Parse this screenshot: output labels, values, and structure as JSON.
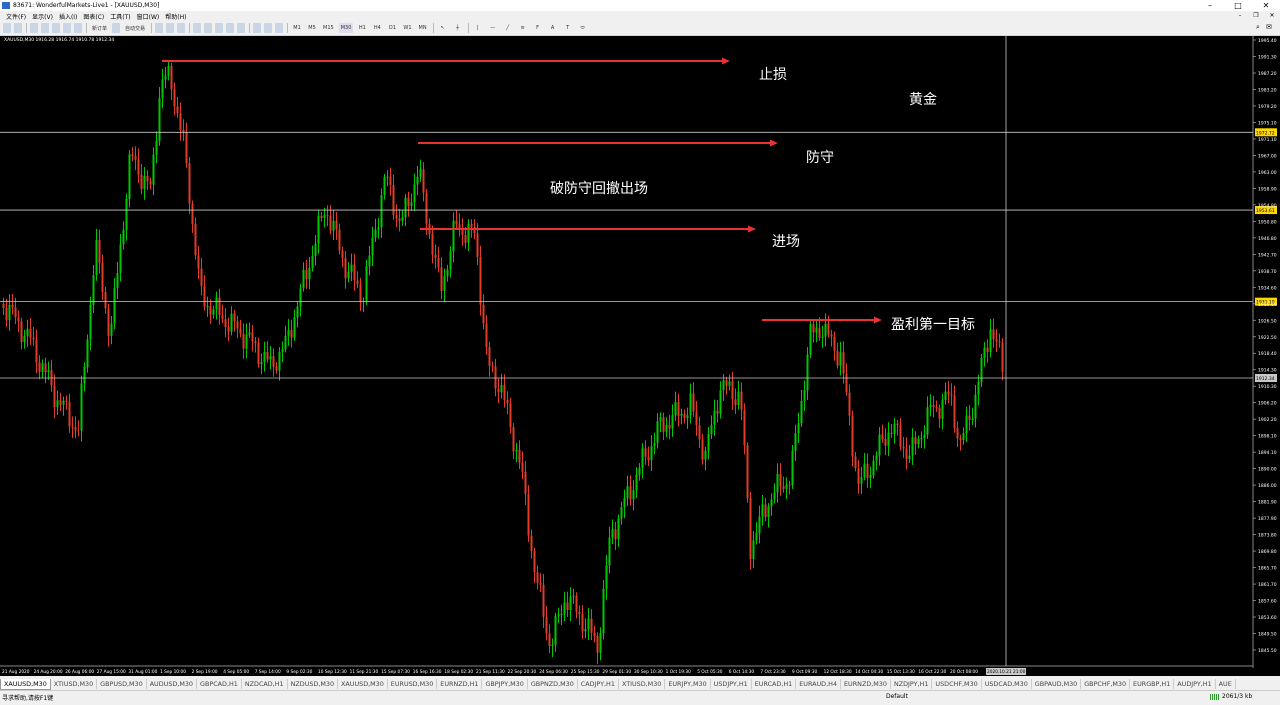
{
  "window": {
    "title": "83671: WonderfulMarkets-Live1 - [XAUUSD,M30]",
    "icon": "terminal-icon"
  },
  "menu": [
    "文件(F)",
    "显示(V)",
    "插入(I)",
    "图表(C)",
    "工具(T)",
    "窗口(W)",
    "帮助(H)"
  ],
  "toolbar": {
    "new_order": "新订单",
    "auto_trading": "自动交易",
    "timeframes": [
      "M1",
      "M5",
      "M15",
      "M30",
      "H1",
      "H4",
      "D1",
      "W1",
      "MN"
    ]
  },
  "chart": {
    "symbol_info": "XAUUSD,M30  1916.28 1916.74 1910.78 1912.34",
    "annotations": {
      "stop_loss": "止损",
      "gold": "黄金",
      "defense": "防守",
      "break_defense": "破防守回撤出场",
      "entry": "进场",
      "take_profit_1": "盈利第一目标"
    },
    "price_labels": [
      "1995.40",
      "1991.30",
      "1987.20",
      "1983.20",
      "1979.20",
      "1975.10",
      "1971.10",
      "1967.00",
      "1963.00",
      "1958.90",
      "1954.90",
      "1950.80",
      "1946.80",
      "1942.70",
      "1938.70",
      "1934.60",
      "1930.60",
      "1926.50",
      "1922.50",
      "1918.40",
      "1914.30",
      "1910.30",
      "1906.20",
      "1902.20",
      "1898.10",
      "1894.10",
      "1890.00",
      "1886.00",
      "1881.90",
      "1877.90",
      "1873.80",
      "1869.80",
      "1865.70",
      "1861.70",
      "1857.60",
      "1853.60",
      "1849.50",
      "1845.50"
    ],
    "level_labels": [
      "1972.72",
      "1953.61",
      "1931.10",
      "1912.34"
    ],
    "time_labels": [
      "21 Aug 2020",
      "24 Aug 20:00",
      "26 Aug 06:00",
      "27 Aug 15:00",
      "31 Aug 01:00",
      "1 Sep 10:00",
      "2 Sep 19:00",
      "4 Sep 05:00",
      "7 Sep 14:00",
      "9 Sep 02:30",
      "10 Sep 12:30",
      "11 Sep 21:30",
      "15 Sep 07:30",
      "16 Sep 16:30",
      "18 Sep 02:30",
      "21 Sep 11:30",
      "22 Sep 20:30",
      "24 Sep 06:30",
      "25 Sep 15:30",
      "29 Sep 01:30",
      "30 Sep 10:30",
      "1 Oct 19:30",
      "5 Oct 05:30",
      "6 Oct 14:30",
      "7 Oct 23:30",
      "9 Oct 09:30",
      "12 Oct 18:30",
      "14 Oct 04:30",
      "15 Oct 13:30",
      "16 Oct 22:30",
      "20 Oct 08:00"
    ],
    "crosshair_time": "2020.10.21 21:00",
    "colors": {
      "up": "#00c800",
      "down": "#e03c28",
      "arrow": "#e83232",
      "hline": "#c8c8c8"
    }
  },
  "tabs": [
    "XAUUSD,M30",
    "XTIUSD,M30",
    "GBPUSD,M30",
    "AUDUSD,M30",
    "GBPCAD,H1",
    "NZDCAD,H1",
    "NZDUSD,M30",
    "XAUUSD,M30",
    "EURUSD,M30",
    "EURNZD,H1",
    "GBPJPY,M30",
    "GBPNZD,M30",
    "CADJPY,H1",
    "XTIUSD,M30",
    "EURJPY,M30",
    "USDJPY,H1",
    "EURCAD,H1",
    "EURAUD,H4",
    "EURNZD,M30",
    "NZDJPY,H1",
    "USDCHF,M30",
    "USDCAD,M30",
    "GBPAUD,M30",
    "GBPCHF,M30",
    "EURGBP,H1",
    "AUDJPY,H1",
    "AUE"
  ],
  "status": {
    "help": "寻求帮助,请按F1键",
    "profile": "Default",
    "traffic": "2061/3 kb"
  }
}
